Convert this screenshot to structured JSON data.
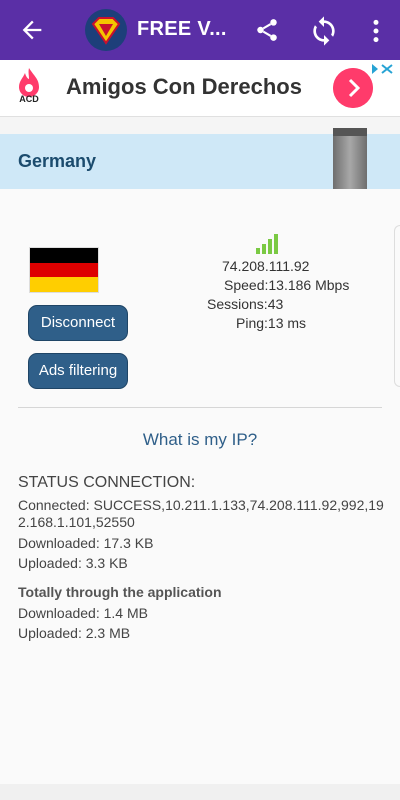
{
  "appbar": {
    "title": "FREE V...",
    "icons": [
      "back-arrow-icon",
      "superman-logo-icon",
      "share-icon",
      "sync-icon",
      "more-vert-icon"
    ]
  },
  "ad": {
    "logo_text": "ACD",
    "title": "Amigos Con Derechos",
    "accent": "#ff3b6b"
  },
  "country": {
    "name": "Germany"
  },
  "controls": {
    "disconnect_label": "Disconnect",
    "ads_filtering_label": "Ads filtering"
  },
  "server": {
    "ip": "74.208.111.92",
    "speed": "Speed:13.186 Mbps",
    "sessions": "Sessions:43",
    "ping": "Ping:13 ms"
  },
  "what_ip_label": "What is my IP?",
  "status": {
    "title": "STATUS CONNECTION:",
    "connected": "Connected: SUCCESS,10.211.1.133,74.208.111.92,992,192.168.1.101,52550",
    "downloaded": "Downloaded: 17.3 KB",
    "uploaded": "Uploaded: 3.3 KB"
  },
  "totals": {
    "title": "Totally through the application",
    "downloaded": "Downloaded: 1.4 MB",
    "uploaded": "Uploaded: 2.3 MB"
  },
  "colors": {
    "appbar": "#5a2fa6",
    "country_bar": "#cfe8f7",
    "button": "#2f5f89",
    "signal": "#7ac943"
  }
}
